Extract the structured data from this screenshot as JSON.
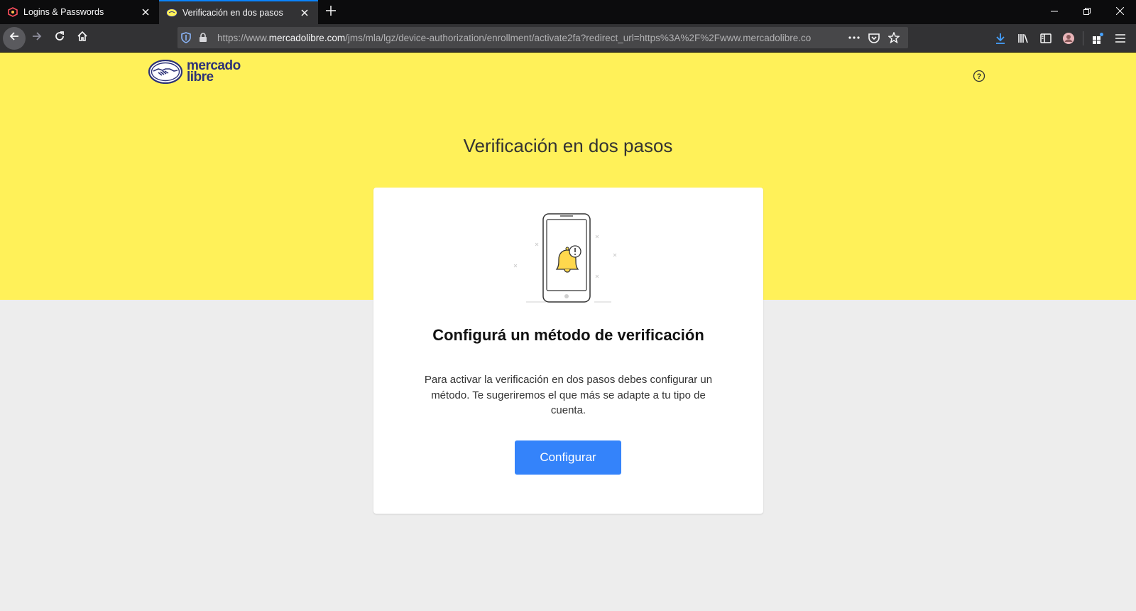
{
  "browser": {
    "tabs": [
      {
        "label": "Logins & Passwords",
        "active": false
      },
      {
        "label": "Verificación en dos pasos",
        "active": true
      }
    ],
    "url_prefix": "https://www.",
    "url_domain": "mercadolibre.com",
    "url_rest": "/jms/mla/lgz/device-authorization/enrollment/activate2fa?redirect_url=https%3A%2F%2Fwww.mercadolibre.co",
    "accent_color": "#0a84ff"
  },
  "page": {
    "logo_line1": "mercado",
    "logo_line2": "libre",
    "help_glyph": "?",
    "title": "Verificación en dos pasos",
    "card": {
      "heading": "Configurá un método de verificación",
      "description": "Para activar la verificación en dos pasos debes configurar un método. Te sugeriremos el que más se adapte a tu tipo de cuenta.",
      "button_label": "Configurar"
    },
    "colors": {
      "hero_bg": "#fff159",
      "page_bg": "#ededed",
      "button_bg": "#3483fa",
      "logo_navy": "#2d3277"
    }
  },
  "icons": [
    "mozilla-vpn-icon",
    "mercadolibre-favicon",
    "close-icon",
    "plus-icon",
    "minimize-icon",
    "restore-icon",
    "back-icon",
    "forward-icon",
    "reload-icon",
    "home-icon",
    "shield-icon",
    "lock-icon",
    "more-icon",
    "pocket-icon",
    "star-icon",
    "download-icon",
    "library-icon",
    "sidebar-icon",
    "account-icon",
    "extensions-icon",
    "menu-icon",
    "help-icon",
    "phone-bell-illustration"
  ]
}
